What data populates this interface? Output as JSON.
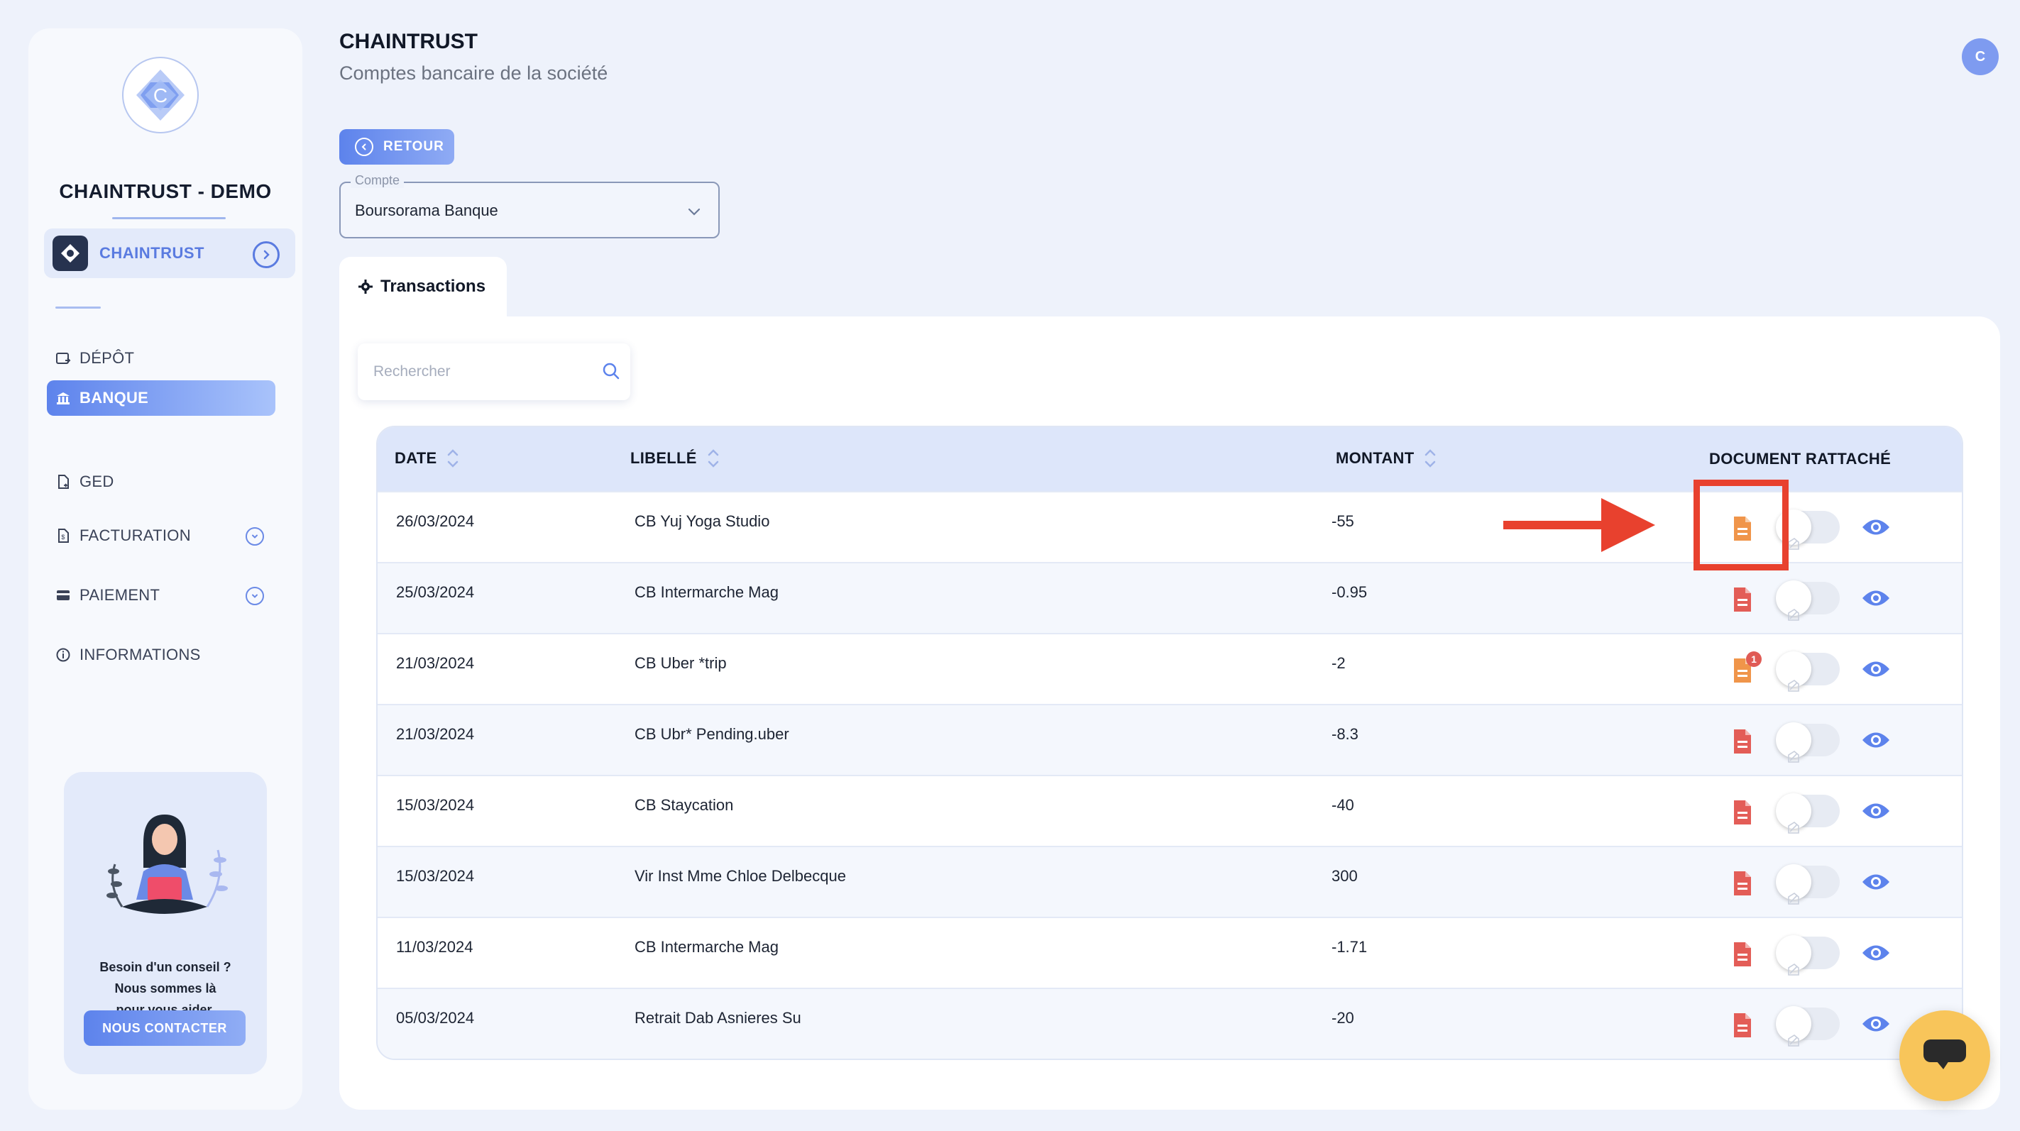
{
  "sidebar": {
    "company_name": "CHAINTRUST - DEMO",
    "org_label": "CHAINTRUST",
    "nav": [
      {
        "label": "DÉPÔT",
        "icon": "deposit-icon",
        "active": false
      },
      {
        "label": "BANQUE",
        "icon": "bank-icon",
        "active": true
      },
      {
        "label": "GED",
        "icon": "document-icon",
        "active": false
      },
      {
        "label": "FACTURATION",
        "icon": "invoice-icon",
        "active": false,
        "expandable": true
      },
      {
        "label": "PAIEMENT",
        "icon": "card-icon",
        "active": false,
        "expandable": true
      },
      {
        "label": "INFORMATIONS",
        "icon": "info-icon",
        "active": false
      }
    ],
    "help": {
      "line1": "Besoin d'un conseil ?",
      "line2": "Nous sommes là",
      "line3": "pour vous aider.",
      "button": "NOUS CONTACTER"
    }
  },
  "header": {
    "title": "CHAINTRUST",
    "subtitle": "Comptes bancaire de la société",
    "avatar_initial": "C",
    "back_label": "RETOUR"
  },
  "account_select": {
    "legend": "Compte",
    "value": "Boursorama Banque"
  },
  "tabs": [
    {
      "label": "Transactions",
      "active": true
    }
  ],
  "search": {
    "placeholder": "Rechercher"
  },
  "table": {
    "columns": [
      "DATE",
      "LIBELLÉ",
      "MONTANT",
      "DOCUMENT RATTACHÉ"
    ],
    "rows": [
      {
        "date": "26/03/2024",
        "label": "CB Yuj Yoga Studio",
        "amount": "-55",
        "doc_color": "#f0954a",
        "badge": ""
      },
      {
        "date": "25/03/2024",
        "label": "CB Intermarche Mag",
        "amount": "-0.95",
        "doc_color": "#e35d57",
        "badge": ""
      },
      {
        "date": "21/03/2024",
        "label": "CB Uber *trip",
        "amount": "-2",
        "doc_color": "#f0954a",
        "badge": "1"
      },
      {
        "date": "21/03/2024",
        "label": "CB Ubr* Pending.uber",
        "amount": "-8.3",
        "doc_color": "#e35d57",
        "badge": ""
      },
      {
        "date": "15/03/2024",
        "label": "CB Staycation",
        "amount": "-40",
        "doc_color": "#e35d57",
        "badge": ""
      },
      {
        "date": "15/03/2024",
        "label": "Vir Inst Mme Chloe Delbecque",
        "amount": "300",
        "doc_color": "#e35d57",
        "badge": ""
      },
      {
        "date": "11/03/2024",
        "label": "CB Intermarche Mag",
        "amount": "-1.71",
        "doc_color": "#e35d57",
        "badge": ""
      },
      {
        "date": "05/03/2024",
        "label": "Retrait Dab Asnieres Su",
        "amount": "-20",
        "doc_color": "#e35d57",
        "badge": ""
      }
    ]
  },
  "colors": {
    "accent": "#5d83ec",
    "annotation": "#e8412e",
    "chat": "#f8c55a"
  }
}
